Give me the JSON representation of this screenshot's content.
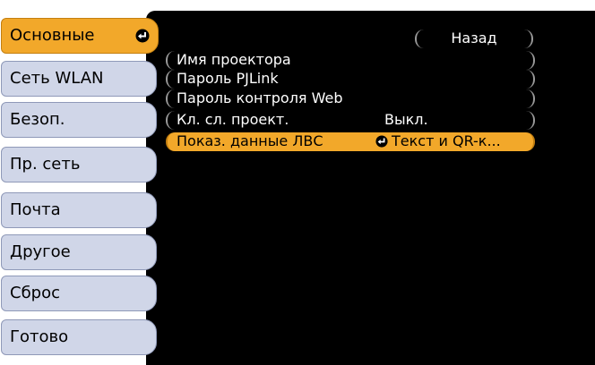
{
  "sidebar": {
    "items": [
      {
        "label": "Основные",
        "selected": true
      },
      {
        "label": "Сеть WLAN",
        "selected": false
      },
      {
        "label": "Безоп.",
        "selected": false
      },
      {
        "label": "Пр. сеть",
        "selected": false
      },
      {
        "label": "Почта",
        "selected": false
      },
      {
        "label": "Другое",
        "selected": false
      },
      {
        "label": "Сброс",
        "selected": false
      },
      {
        "label": "Готово",
        "selected": false
      }
    ]
  },
  "main": {
    "back_label": "Назад",
    "rows": [
      {
        "label": "Имя проектора",
        "value": ""
      },
      {
        "label": "Пароль PJLink",
        "value": ""
      },
      {
        "label": "Пароль контроля Web",
        "value": ""
      },
      {
        "label": "Кл. сл. проект.",
        "value": "Выкл."
      },
      {
        "label": "Показ. данные ЛВС",
        "value": "Текст и QR-к..."
      }
    ]
  },
  "colors": {
    "highlight": "#f2a82a",
    "sidebar_item": "#d0d6e8",
    "panel": "#000000"
  },
  "icons": {
    "enter": "enter-icon"
  }
}
